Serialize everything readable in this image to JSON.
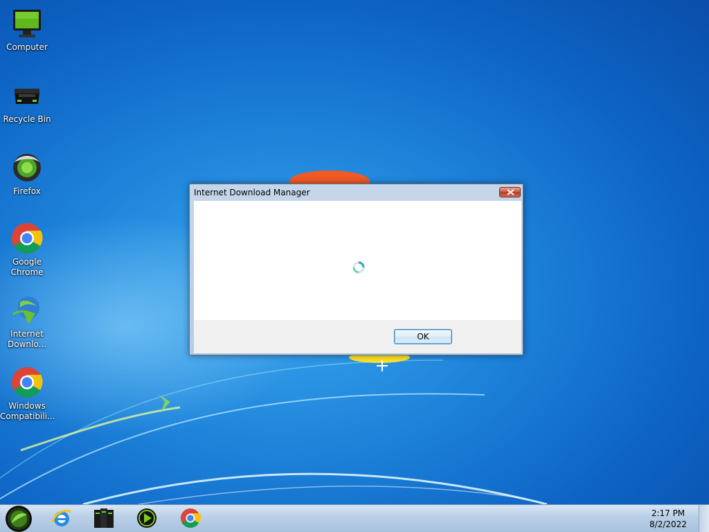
{
  "desktop": {
    "icons": [
      {
        "label": "Computer",
        "icon": "computer-icon"
      },
      {
        "label": "Recycle Bin",
        "icon": "recycle-bin-icon"
      },
      {
        "label": "Firefox",
        "icon": "firefox-icon"
      },
      {
        "label": "Google\nChrome",
        "icon": "chrome-icon"
      },
      {
        "label": "Internet\nDownlo...",
        "icon": "idm-icon"
      },
      {
        "label": "Windows\nCompatibili...",
        "icon": "chrome-icon"
      }
    ]
  },
  "dialog": {
    "title": "Internet Download Manager",
    "ok_label": "OK",
    "close_icon": "close-icon",
    "status": "loading"
  },
  "taskbar": {
    "pinned": [
      {
        "name": "internet-explorer",
        "icon": "ie-icon"
      },
      {
        "name": "file-manager",
        "icon": "folders-icon"
      },
      {
        "name": "media-player",
        "icon": "media-player-icon"
      },
      {
        "name": "google-chrome",
        "icon": "chrome-icon"
      }
    ],
    "clock": {
      "time": "2:17 PM",
      "date": "8/2/2022"
    }
  },
  "colors": {
    "wallpaper_blue": "#1f86dc",
    "taskbar": "#b9cfe6",
    "close_button": "#c9503a",
    "ok_border": "#3c7fb1",
    "accent_green": "#7ec820"
  }
}
